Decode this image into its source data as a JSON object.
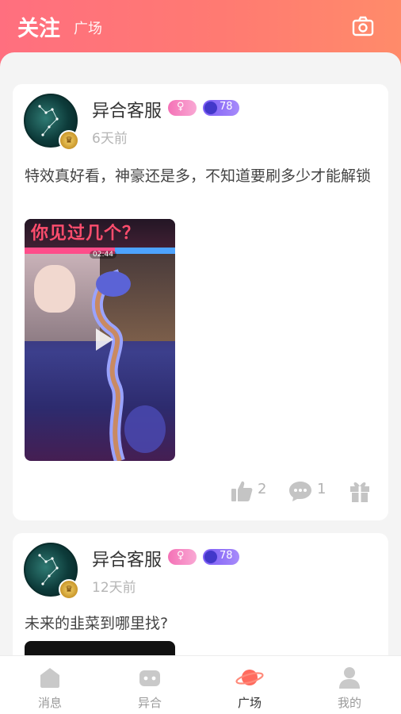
{
  "header": {
    "active_tab": "关注",
    "other_tab": "广场",
    "camera_icon": "camera-icon"
  },
  "posts": [
    {
      "username": "异合客服",
      "gender_symbol": "♀",
      "level": "78",
      "time": "6天前",
      "text": "特效真好看，神豪还是多，不知道要刷多少才能解锁",
      "video_banner_text": "你见过几个？",
      "video_time_label": "02:44",
      "likes": "2",
      "comments": "1"
    },
    {
      "username": "异合客服",
      "gender_symbol": "♀",
      "level": "78",
      "time": "12天前",
      "text": "未来的韭菜到哪里找?"
    }
  ],
  "tabbar": [
    {
      "label": "消息",
      "icon": "message-icon",
      "active": false
    },
    {
      "label": "异合",
      "icon": "game-controller-icon",
      "active": false
    },
    {
      "label": "广场",
      "icon": "planet-icon",
      "active": true
    },
    {
      "label": "我的",
      "icon": "profile-icon",
      "active": false
    }
  ],
  "colors": {
    "header_start": "#ff6f7f",
    "header_end": "#ff8b6a",
    "accent": "#ff6b6b",
    "muted_text": "#b5b5b5"
  }
}
